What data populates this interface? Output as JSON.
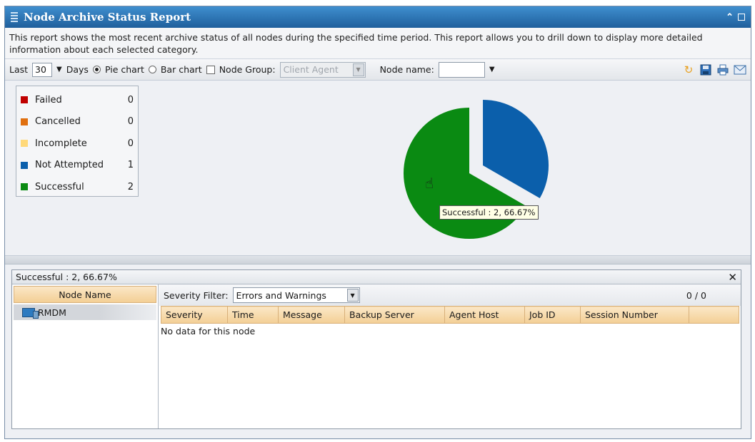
{
  "window": {
    "title": "Node Archive Status Report"
  },
  "description": "This report shows the most recent archive status of all nodes during the specified time period. This report allows you to drill down to display more detailed information about each selected category.",
  "toolbar": {
    "last_label": "Last",
    "days_value": "30",
    "days_label": "Days",
    "pie_label": "Pie chart",
    "bar_label": "Bar chart",
    "selected_chart": "Pie chart",
    "node_group_label": "Node Group:",
    "node_group_value": "Client Agent",
    "node_name_label": "Node name:",
    "node_name_value": "",
    "icons": [
      "refresh-icon",
      "save-icon",
      "print-icon",
      "email-icon"
    ]
  },
  "legend": [
    {
      "label": "Failed",
      "count": "0",
      "color": "#c00000"
    },
    {
      "label": "Cancelled",
      "count": "0",
      "color": "#e07010"
    },
    {
      "label": "Incomplete",
      "count": "0",
      "color": "#ffd97a"
    },
    {
      "label": "Not Attempted",
      "count": "1",
      "color": "#0b5fab"
    },
    {
      "label": "Successful",
      "count": "2",
      "color": "#0a8a12"
    }
  ],
  "chart_data": {
    "type": "pie",
    "slices": [
      {
        "label": "Not Attempted",
        "value": 1,
        "color": "#0b5fab"
      },
      {
        "label": "Successful",
        "value": 2,
        "color": "#0a8a12"
      }
    ],
    "tooltip": "Successful : 2, 66.67%"
  },
  "detail": {
    "title": "Successful : 2, 66.67%",
    "node_name_header": "Node Name",
    "nodes": [
      "RMDM"
    ],
    "severity_filter_label": "Severity Filter:",
    "severity_filter_value": "Errors and Warnings",
    "pager": "0 / 0",
    "columns": [
      "Severity",
      "Time",
      "Message",
      "Backup Server",
      "Agent Host",
      "Job ID",
      "Session Number",
      ""
    ],
    "empty_message": "No data for this node"
  }
}
